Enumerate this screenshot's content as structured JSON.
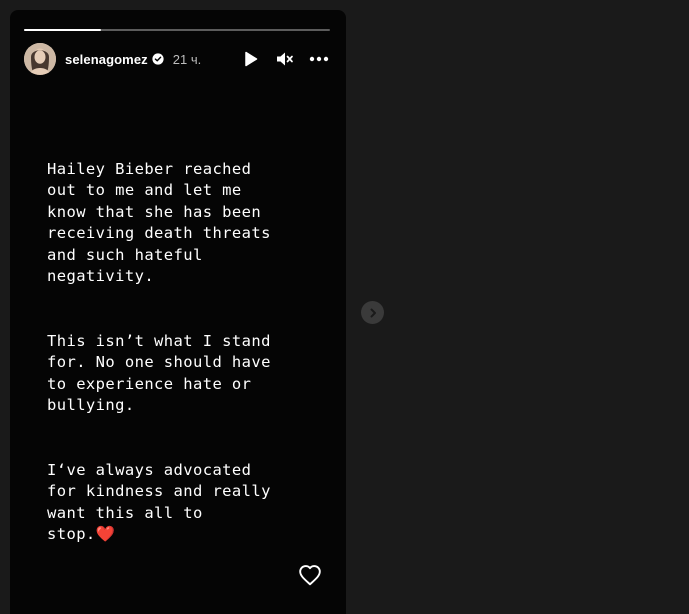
{
  "story": {
    "progress": 0.25,
    "author": {
      "username": "selenagomez",
      "verified": true,
      "avatar_icon": "avatar-photo"
    },
    "time_ago": "21 ч.",
    "controls": {
      "play_icon": "play-icon",
      "mute_icon": "muted-speaker-icon",
      "more_icon": "more-options-icon"
    },
    "text": {
      "paragraph_1": "Hailey Bieber reached\nout to me and let me\nknow that she has been\nreceiving death threats\nand such hateful\nnegativity.",
      "paragraph_2": "This isn’t what I stand\nfor. No one should have\nto experience hate or\nbullying.",
      "paragraph_3": "I‘ve always advocated\nfor kindness and really\nwant this all to\nstop.",
      "emoji": "❤️"
    },
    "like_icon": "heart-outline-icon"
  },
  "navigation": {
    "next_icon": "chevron-right-icon"
  },
  "colors": {
    "background": "#1a1a1a",
    "story_bg": "#050505",
    "text": "#ffffff",
    "muted_text": "#bdbdbd",
    "heart": "#e0282e"
  }
}
